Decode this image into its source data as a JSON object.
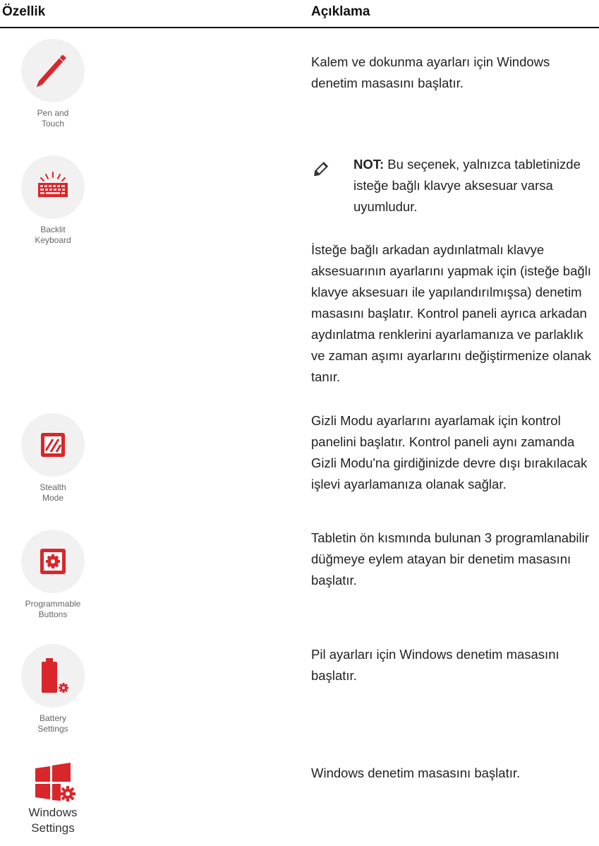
{
  "table": {
    "headers": {
      "feature": "Özellik",
      "description": "Açıklama"
    }
  },
  "features": [
    {
      "icon": "pen-icon",
      "caption": "Pen and\nTouch",
      "description": "Kalem ve dokunma ayarları için Windows denetim masasını başlatır."
    },
    {
      "icon": "backlit-keyboard-icon",
      "caption": "Backlit\nKeyboard",
      "note_label": "NOT:",
      "note_text": " Bu seçenek, yalnızca tabletinizde isteğe bağlı klavye aksesuar varsa uyumludur.",
      "description": "İsteğe bağlı arkadan aydınlatmalı klavye aksesuarının ayarlarını yapmak için (isteğe bağlı klavye aksesuarı ile yapılandırılmışsa) denetim masasını başlatır. Kontrol paneli ayrıca arkadan aydınlatma renklerini ayarlamanıza ve parlaklık ve zaman aşımı ayarlarını değiştirmenize olanak tanır."
    },
    {
      "icon": "stealth-mode-icon",
      "caption": "Stealth\nMode",
      "description": "Gizli Modu ayarlarını ayarlamak için kontrol panelini başlatır. Kontrol paneli aynı zamanda Gizli Modu'na girdiğinizde devre dışı bırakılacak işlevi ayarlamanıza olanak sağlar."
    },
    {
      "icon": "programmable-buttons-icon",
      "caption": "Programmable\nButtons",
      "description": "Tabletin ön kısmında bulunan 3 programlanabilir düğmeye eylem atayan bir denetim masasını başlatır."
    },
    {
      "icon": "battery-settings-icon",
      "caption": "Battery\nSettings",
      "description": "Pil ayarları için Windows denetim masasını başlatır."
    },
    {
      "icon": "windows-settings-icon",
      "caption": "Windows\nSettings",
      "description": "Windows denetim masasını başlatır."
    }
  ],
  "colors": {
    "accent": "#d9262b",
    "circle": "#f1f1f1",
    "rule": "#111111"
  }
}
